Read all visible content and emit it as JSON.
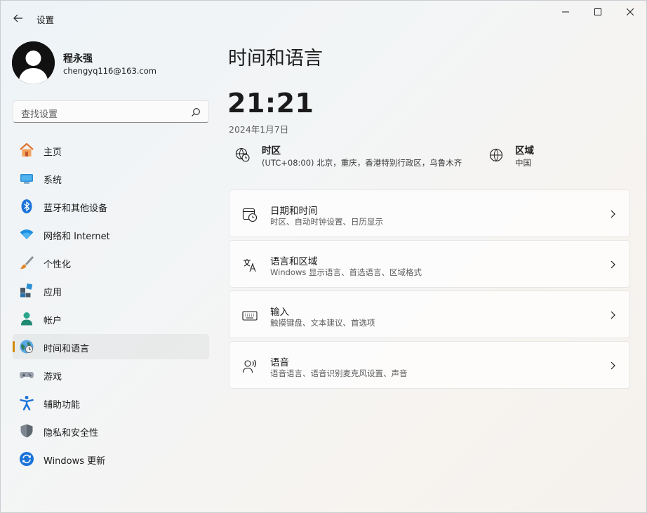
{
  "window": {
    "app_title": "设置",
    "back_icon": "back-arrow-icon",
    "minimize_icon": "minimize-icon",
    "maximize_icon": "maximize-icon",
    "close_icon": "close-icon"
  },
  "profile": {
    "name": "程永强",
    "email": "chengyq116@163.com"
  },
  "search": {
    "placeholder": "查找设置",
    "icon": "search-icon"
  },
  "sidebar": {
    "active_index": 7,
    "accent_color": "#d18a00",
    "items": [
      {
        "label": "主页",
        "icon": "home-icon"
      },
      {
        "label": "系统",
        "icon": "system-icon"
      },
      {
        "label": "蓝牙和其他设备",
        "icon": "bluetooth-icon"
      },
      {
        "label": "网络和 Internet",
        "icon": "wifi-icon"
      },
      {
        "label": "个性化",
        "icon": "brush-icon"
      },
      {
        "label": "应用",
        "icon": "apps-icon"
      },
      {
        "label": "帐户",
        "icon": "account-icon"
      },
      {
        "label": "时间和语言",
        "icon": "time-language-icon"
      },
      {
        "label": "游戏",
        "icon": "gamepad-icon"
      },
      {
        "label": "辅助功能",
        "icon": "accessibility-icon"
      },
      {
        "label": "隐私和安全性",
        "icon": "shield-icon"
      },
      {
        "label": "Windows 更新",
        "icon": "update-icon"
      }
    ]
  },
  "main": {
    "title": "时间和语言",
    "clock": "21:21",
    "date": "2024年1月7日",
    "timezone": {
      "title": "时区",
      "value": "(UTC+08:00) 北京，重庆，香港特别行政区，乌鲁木齐",
      "icon": "timezone-icon"
    },
    "region": {
      "title": "区域",
      "value": "中国",
      "icon": "globe-icon"
    },
    "cards": [
      {
        "title": "日期和时间",
        "subtitle": "时区、自动时钟设置、日历显示",
        "icon": "calendar-clock-icon"
      },
      {
        "title": "语言和区域",
        "subtitle": "Windows 显示语言、首选语言、区域格式",
        "icon": "language-icon"
      },
      {
        "title": "输入",
        "subtitle": "触摸键盘、文本建议、首选项",
        "icon": "keyboard-icon"
      },
      {
        "title": "语音",
        "subtitle": "语音语言、语音识别麦克风设置、声音",
        "icon": "speech-icon"
      }
    ]
  }
}
